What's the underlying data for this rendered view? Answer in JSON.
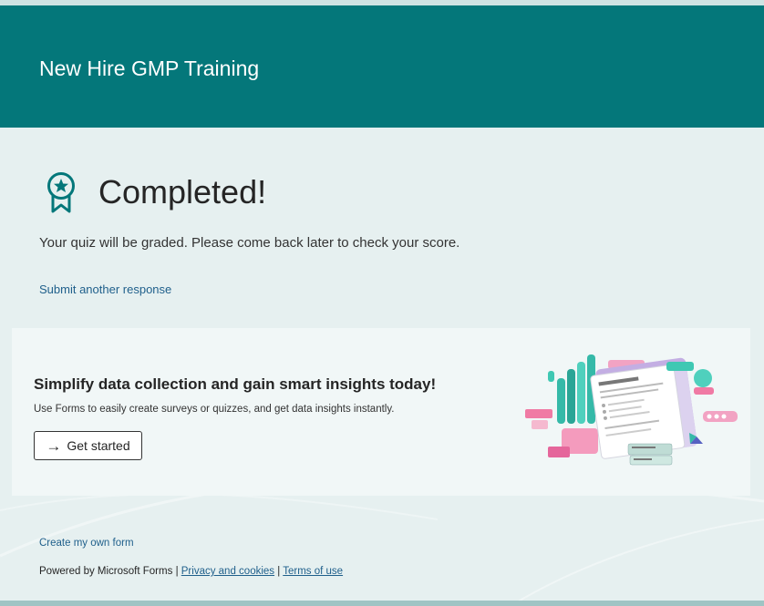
{
  "header": {
    "title": "New Hire GMP Training"
  },
  "status": {
    "icon": "award-ribbon-icon",
    "title": "Completed!",
    "message": "Your quiz will be graded. Please come back later to check your score."
  },
  "actions": {
    "submit_another": "Submit another response"
  },
  "promo": {
    "title": "Simplify data collection and gain smart insights today!",
    "subtitle": "Use Forms to easily create surveys or quizzes, and get data insights instantly.",
    "button_label": "Get started",
    "button_icon": "arrow-right-icon"
  },
  "footer": {
    "create_link": "Create my own form",
    "powered_by": "Powered by Microsoft Forms",
    "separator": "|",
    "privacy_link": "Privacy and cookies",
    "terms_link": "Terms of use"
  },
  "colors": {
    "header_bg": "#04777a",
    "page_bg": "#e6f0f0",
    "link": "#1f5f8b"
  }
}
